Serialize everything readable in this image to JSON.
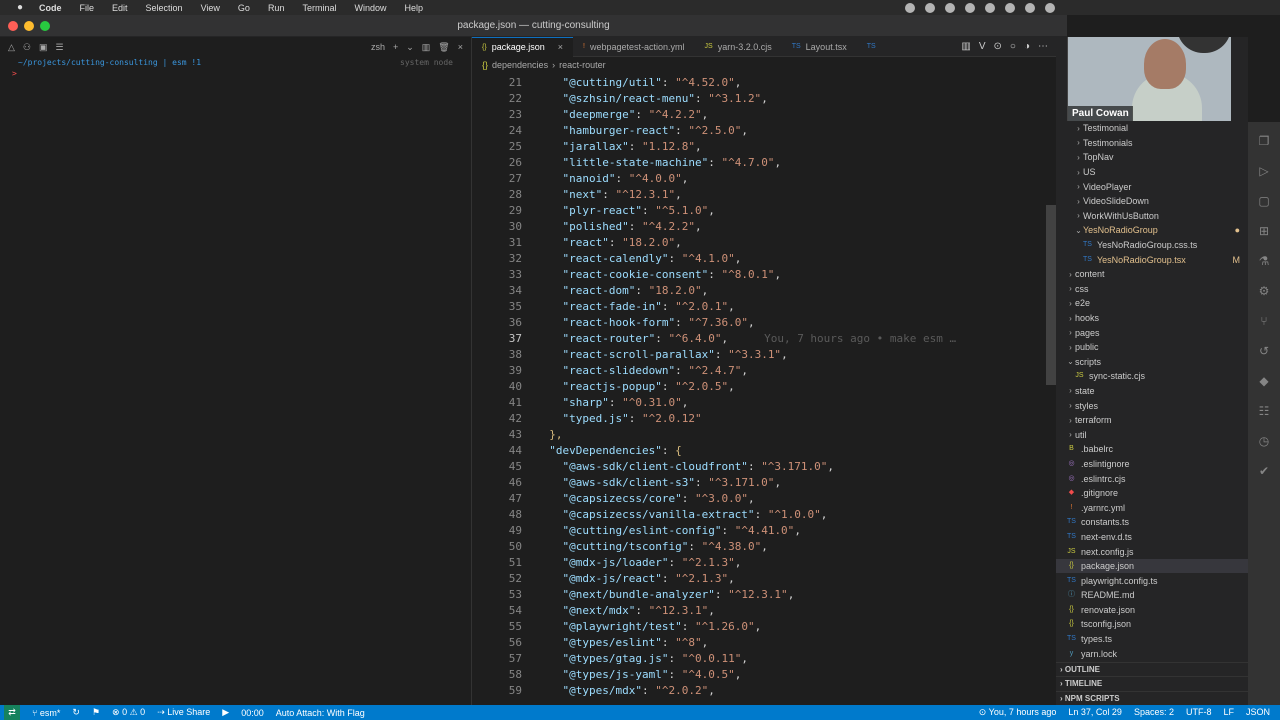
{
  "mac_menu": {
    "apple": "",
    "items": [
      "Code",
      "File",
      "Edit",
      "Selection",
      "View",
      "Go",
      "Run",
      "Terminal",
      "Window",
      "Help"
    ]
  },
  "window_title": "package.json — cutting-consulting",
  "terminal": {
    "tab_label": "zsh",
    "path": "~/projects/cutting-consulting",
    "branch": "esm !1",
    "status": "system node",
    "prompt": ">"
  },
  "editor": {
    "tabs": [
      {
        "label": "package.json",
        "icon": "{}",
        "active": true
      },
      {
        "label": "webpagetest-action.yml",
        "icon": "!",
        "active": false
      },
      {
        "label": "yarn-3.2.0.cjs",
        "icon": "JS",
        "active": false
      },
      {
        "label": "Layout.tsx",
        "icon": "TS",
        "active": false
      },
      {
        "label": "",
        "icon": "TS",
        "active": false
      }
    ],
    "breadcrumbs": [
      "dependencies",
      "react-router"
    ],
    "blame": "You, 7 hours ago • make esm …",
    "current_line": 37,
    "lines": [
      {
        "n": 21,
        "k": "@cutting/util",
        "v": "^4.52.0",
        "indent": 2
      },
      {
        "n": 22,
        "k": "@szhsin/react-menu",
        "v": "^3.1.2",
        "indent": 2
      },
      {
        "n": 23,
        "k": "deepmerge",
        "v": "^4.2.2",
        "indent": 2
      },
      {
        "n": 24,
        "k": "hamburger-react",
        "v": "^2.5.0",
        "indent": 2
      },
      {
        "n": 25,
        "k": "jarallax",
        "v": "1.12.8",
        "indent": 2
      },
      {
        "n": 26,
        "k": "little-state-machine",
        "v": "^4.7.0",
        "indent": 2
      },
      {
        "n": 27,
        "k": "nanoid",
        "v": "^4.0.0",
        "indent": 2
      },
      {
        "n": 28,
        "k": "next",
        "v": "^12.3.1",
        "indent": 2
      },
      {
        "n": 29,
        "k": "plyr-react",
        "v": "^5.1.0",
        "indent": 2
      },
      {
        "n": 30,
        "k": "polished",
        "v": "^4.2.2",
        "indent": 2
      },
      {
        "n": 31,
        "k": "react",
        "v": "18.2.0",
        "indent": 2
      },
      {
        "n": 32,
        "k": "react-calendly",
        "v": "^4.1.0",
        "indent": 2
      },
      {
        "n": 33,
        "k": "react-cookie-consent",
        "v": "^8.0.1",
        "indent": 2
      },
      {
        "n": 34,
        "k": "react-dom",
        "v": "18.2.0",
        "indent": 2
      },
      {
        "n": 35,
        "k": "react-fade-in",
        "v": "^2.0.1",
        "indent": 2
      },
      {
        "n": 36,
        "k": "react-hook-form",
        "v": "^7.36.0",
        "indent": 2
      },
      {
        "n": 37,
        "k": "react-router",
        "v": "^6.4.0",
        "indent": 2
      },
      {
        "n": 38,
        "k": "react-scroll-parallax",
        "v": "^3.3.1",
        "indent": 2
      },
      {
        "n": 39,
        "k": "react-slidedown",
        "v": "^2.4.7",
        "indent": 2
      },
      {
        "n": 40,
        "k": "reactjs-popup",
        "v": "^2.0.5",
        "indent": 2
      },
      {
        "n": 41,
        "k": "sharp",
        "v": "^0.31.0",
        "indent": 2
      },
      {
        "n": 42,
        "k": "typed.js",
        "v": "^2.0.12",
        "indent": 2,
        "last": true
      },
      {
        "n": 43,
        "raw": "},",
        "indent": 1
      },
      {
        "n": 44,
        "k": "devDependencies",
        "raw_after": ": {",
        "indent": 1
      },
      {
        "n": 45,
        "k": "@aws-sdk/client-cloudfront",
        "v": "^3.171.0",
        "indent": 2
      },
      {
        "n": 46,
        "k": "@aws-sdk/client-s3",
        "v": "^3.171.0",
        "indent": 2
      },
      {
        "n": 47,
        "k": "@capsizecss/core",
        "v": "^3.0.0",
        "indent": 2
      },
      {
        "n": 48,
        "k": "@capsizecss/vanilla-extract",
        "v": "^1.0.0",
        "indent": 2
      },
      {
        "n": 49,
        "k": "@cutting/eslint-config",
        "v": "^4.41.0",
        "indent": 2
      },
      {
        "n": 50,
        "k": "@cutting/tsconfig",
        "v": "^4.38.0",
        "indent": 2
      },
      {
        "n": 51,
        "k": "@mdx-js/loader",
        "v": "^2.1.3",
        "indent": 2
      },
      {
        "n": 52,
        "k": "@mdx-js/react",
        "v": "^2.1.3",
        "indent": 2
      },
      {
        "n": 53,
        "k": "@next/bundle-analyzer",
        "v": "^12.3.1",
        "indent": 2
      },
      {
        "n": 54,
        "k": "@next/mdx",
        "v": "^12.3.1",
        "indent": 2
      },
      {
        "n": 55,
        "k": "@playwright/test",
        "v": "^1.26.0",
        "indent": 2
      },
      {
        "n": 56,
        "k": "@types/eslint",
        "v": "^8",
        "indent": 2
      },
      {
        "n": 57,
        "k": "@types/gtag.js",
        "v": "^0.0.11",
        "indent": 2
      },
      {
        "n": 58,
        "k": "@types/js-yaml",
        "v": "^4.0.5",
        "indent": 2
      },
      {
        "n": 59,
        "k": "@types/mdx",
        "v": "^2.0.2",
        "indent": 2
      }
    ]
  },
  "video": {
    "name": "Paul Cowan"
  },
  "explorer": {
    "items": [
      {
        "label": "Testimonial",
        "type": "folder",
        "depth": 1
      },
      {
        "label": "Testimonials",
        "type": "folder",
        "depth": 1
      },
      {
        "label": "TopNav",
        "type": "folder",
        "depth": 1
      },
      {
        "label": "US",
        "type": "folder",
        "depth": 1
      },
      {
        "label": "VideoPlayer",
        "type": "folder",
        "depth": 1
      },
      {
        "label": "VideoSlideDown",
        "type": "folder",
        "depth": 1
      },
      {
        "label": "WorkWithUsButton",
        "type": "folder",
        "depth": 1
      },
      {
        "label": "YesNoRadioGroup",
        "type": "folder-open",
        "depth": 1,
        "modified": true,
        "badge": "●"
      },
      {
        "label": "YesNoRadioGroup.css.ts",
        "type": "ts",
        "depth": 2
      },
      {
        "label": "YesNoRadioGroup.tsx",
        "type": "ts",
        "depth": 2,
        "modified": true,
        "badge": "M"
      },
      {
        "label": "content",
        "type": "folder",
        "depth": 0
      },
      {
        "label": "css",
        "type": "folder",
        "depth": 0
      },
      {
        "label": "e2e",
        "type": "folder",
        "depth": 0
      },
      {
        "label": "hooks",
        "type": "folder",
        "depth": 0
      },
      {
        "label": "pages",
        "type": "folder",
        "depth": 0
      },
      {
        "label": "public",
        "type": "folder",
        "depth": 0
      },
      {
        "label": "scripts",
        "type": "folder-open",
        "depth": 0
      },
      {
        "label": "sync-static.cjs",
        "type": "js",
        "depth": 1
      },
      {
        "label": "state",
        "type": "folder",
        "depth": 0
      },
      {
        "label": "styles",
        "type": "folder",
        "depth": 0
      },
      {
        "label": "terraform",
        "type": "folder",
        "depth": 0
      },
      {
        "label": "util",
        "type": "folder",
        "depth": 0
      },
      {
        "label": ".babelrc",
        "type": "babel",
        "depth": 0
      },
      {
        "label": ".eslintignore",
        "type": "eslint",
        "depth": 0
      },
      {
        "label": ".eslintrc.cjs",
        "type": "eslint",
        "depth": 0
      },
      {
        "label": ".gitignore",
        "type": "git",
        "depth": 0
      },
      {
        "label": ".yarnrc.yml",
        "type": "yml",
        "depth": 0
      },
      {
        "label": "constants.ts",
        "type": "ts",
        "depth": 0
      },
      {
        "label": "next-env.d.ts",
        "type": "ts",
        "depth": 0
      },
      {
        "label": "next.config.js",
        "type": "js",
        "depth": 0
      },
      {
        "label": "package.json",
        "type": "json",
        "depth": 0,
        "selected": true
      },
      {
        "label": "playwright.config.ts",
        "type": "ts",
        "depth": 0
      },
      {
        "label": "README.md",
        "type": "md",
        "depth": 0
      },
      {
        "label": "renovate.json",
        "type": "json",
        "depth": 0
      },
      {
        "label": "tsconfig.json",
        "type": "json",
        "depth": 0
      },
      {
        "label": "types.ts",
        "type": "ts",
        "depth": 0
      },
      {
        "label": "yarn.lock",
        "type": "yarn",
        "depth": 0
      }
    ],
    "panels": [
      "OUTLINE",
      "TIMELINE",
      "NPM SCRIPTS"
    ]
  },
  "statusbar": {
    "branch": "esm*",
    "problems": "0 ⚠ 0",
    "live_share": "Live Share",
    "timer": "00:00",
    "auto_attach": "Auto Attach: With Flag",
    "blame": "You, 7 hours ago",
    "position": "Ln 37, Col 29",
    "spaces": "Spaces: 2",
    "encoding": "UTF-8",
    "eol": "LF",
    "language": "JSON"
  }
}
